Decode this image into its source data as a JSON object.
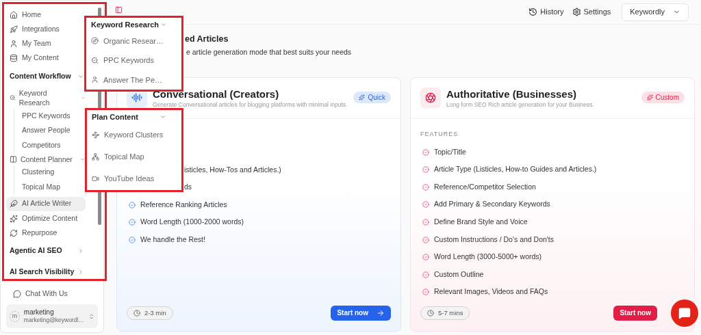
{
  "sidebar": {
    "items": [
      {
        "kind": "link",
        "label": "Home",
        "selected": false
      },
      {
        "kind": "link",
        "label": "Integrations",
        "selected": false
      },
      {
        "kind": "link",
        "label": "My Team",
        "selected": false
      },
      {
        "kind": "link",
        "label": "My Content",
        "selected": false
      },
      {
        "kind": "section",
        "label": "Content Workflow",
        "expanded": true
      },
      {
        "kind": "group",
        "label": "Keyword Research",
        "expanded": true,
        "children": [
          {
            "label": "PPC Keywords",
            "selected": false
          },
          {
            "label": "Answer People",
            "selected": false
          },
          {
            "label": "Competitors",
            "selected": false
          }
        ]
      },
      {
        "kind": "group",
        "label": "Content Planner",
        "expanded": true,
        "children": [
          {
            "label": "Clustering",
            "selected": false
          },
          {
            "label": "Topical Map",
            "selected": false
          }
        ]
      },
      {
        "kind": "link",
        "label": "AI Article Writer",
        "selected": true
      },
      {
        "kind": "link",
        "label": "Optimize Content",
        "selected": false
      },
      {
        "kind": "link",
        "label": "Repurpose",
        "selected": false
      },
      {
        "kind": "section",
        "label": "Agentic AI SEO",
        "expanded": false
      },
      {
        "kind": "section",
        "label": "AI Search Visibility",
        "expanded": false
      }
    ],
    "chat": "Chat With Us",
    "user": {
      "avatar": "m",
      "name": "marketing",
      "email": "marketing@keywordl…"
    }
  },
  "header": {
    "links": [
      "History",
      "Settings"
    ],
    "workspace": "Keywordly"
  },
  "heading": {
    "title": "ed Articles",
    "subtitle": "e article generation mode that best suits your needs"
  },
  "cards": [
    {
      "kind": "quick",
      "title": "Conversational (Creators)",
      "subtitle": "Generate Conversational articles for blogging platforms with minimal inputs.",
      "badge": "Quick",
      "features": [
        {
          "kind": "cut",
          "text": "isticles, How-Tos and Articles.)"
        },
        {
          "kind": "cut",
          "text": "ds"
        },
        {
          "kind": "item",
          "text": "Reference Ranking Articles"
        },
        {
          "kind": "item",
          "text": "Word Length (1000-2000 words)"
        },
        {
          "kind": "item",
          "text": "We handle the Rest!"
        }
      ],
      "time": "2-3 min",
      "button": {
        "label": "Start now"
      }
    },
    {
      "kind": "custom",
      "title": "Authoritative (Businesses)",
      "subtitle": "Long form SEO Rich article generation for your Business.",
      "badge": "Custom",
      "features_label": "FEATURES",
      "features": [
        {
          "kind": "item",
          "text": "Topic/Title"
        },
        {
          "kind": "item",
          "text": "Article Type (Listicles, How-to Guides and Articles.)"
        },
        {
          "kind": "item",
          "text": "Reference/Competitor Selection"
        },
        {
          "kind": "item",
          "text": "Add Primary & Secondary Keywords"
        },
        {
          "kind": "item",
          "text": "Define Brand Style and Voice"
        },
        {
          "kind": "item",
          "text": "Custom Instructions / Do's and Don'ts"
        },
        {
          "kind": "item",
          "text": "Word Length (3000-5000+ words)"
        },
        {
          "kind": "item",
          "text": "Custom Outline"
        },
        {
          "kind": "item",
          "text": "Relevant Images, Videos and FAQs"
        }
      ],
      "time": "5-7 mins",
      "button": {
        "label": "Start now"
      }
    }
  ],
  "popovers": [
    {
      "title": "Keyword Research",
      "items": [
        "Organic Resear…",
        "PPC Keywords",
        "Answer The Pe…"
      ]
    },
    {
      "title": "Plan Content",
      "items": [
        "Keyword Clusters",
        "Topical Map",
        "YouTube Ideas"
      ]
    }
  ]
}
